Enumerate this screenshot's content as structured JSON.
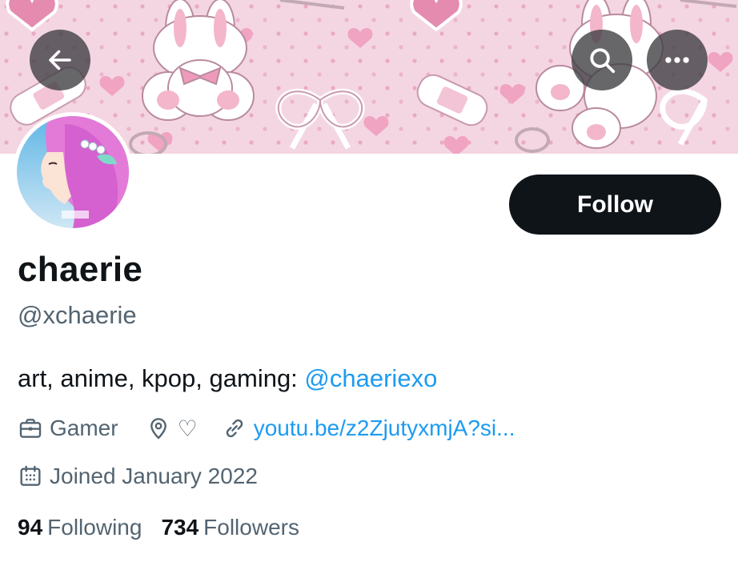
{
  "header": {
    "back_icon": "arrow-left-icon",
    "search_icon": "search-icon",
    "more_icon": "more-horizontal-icon"
  },
  "profile": {
    "display_name": "chaerie",
    "handle": "@xchaerie",
    "bio_text": "art, anime, kpop, gaming: ",
    "bio_mention": "@chaeriexo",
    "follow_label": "Follow",
    "category": "Gamer",
    "location": "♡",
    "website": "youtu.be/z2ZjutyxmjA?si...",
    "joined": "Joined January 2022"
  },
  "stats": {
    "following_count": "94",
    "following_label": "Following",
    "followers_count": "734",
    "followers_label": "Followers"
  },
  "colors": {
    "accent": "#1d9bf0",
    "text": "#0f1419",
    "muted": "#536471",
    "banner_pink": "#f3d3e1"
  }
}
